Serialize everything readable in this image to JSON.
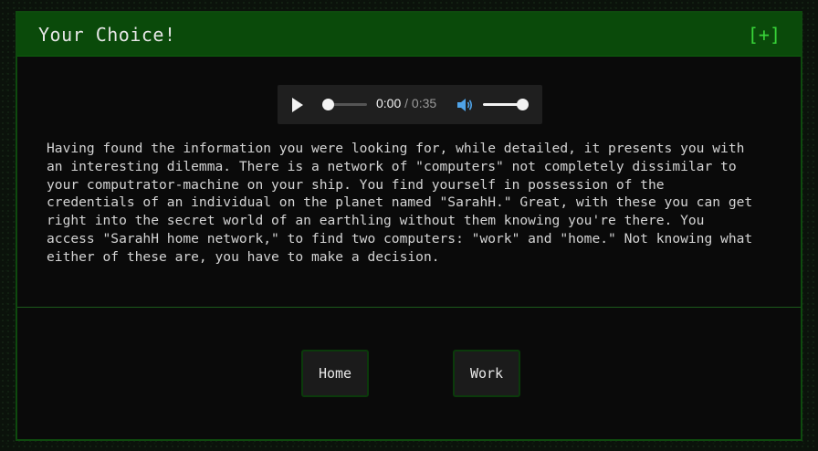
{
  "dialog": {
    "title": "Your Choice!",
    "expand_label": "[+]"
  },
  "audio": {
    "current_time": "0:00",
    "separator": " / ",
    "duration": "0:35",
    "progress": 0.0,
    "volume": 1.0
  },
  "story": {
    "text": "Having found the information you were looking for, while detailed, it presents you with\nan interesting dilemma. There is a network of \"computers\" not completely dissimilar to\nyour computrator-machine on your ship. You find yourself in possession of the\ncredentials of an individual on the planet named \"SarahH.\" Great, with these you can get\nright into the secret world of an earthling without them knowing you're there. You\naccess \"SarahH home network,\" to find two computers: \"work\" and \"home.\" Not knowing what\neither of these are, you have to make a decision."
  },
  "choices": [
    {
      "label": "Home"
    },
    {
      "label": "Work"
    }
  ],
  "colors": {
    "header_bg": "#0a4a0a",
    "accent": "#38d438",
    "panel_bg": "#0a0a0a"
  },
  "icons": [
    "play-icon",
    "volume-icon"
  ]
}
